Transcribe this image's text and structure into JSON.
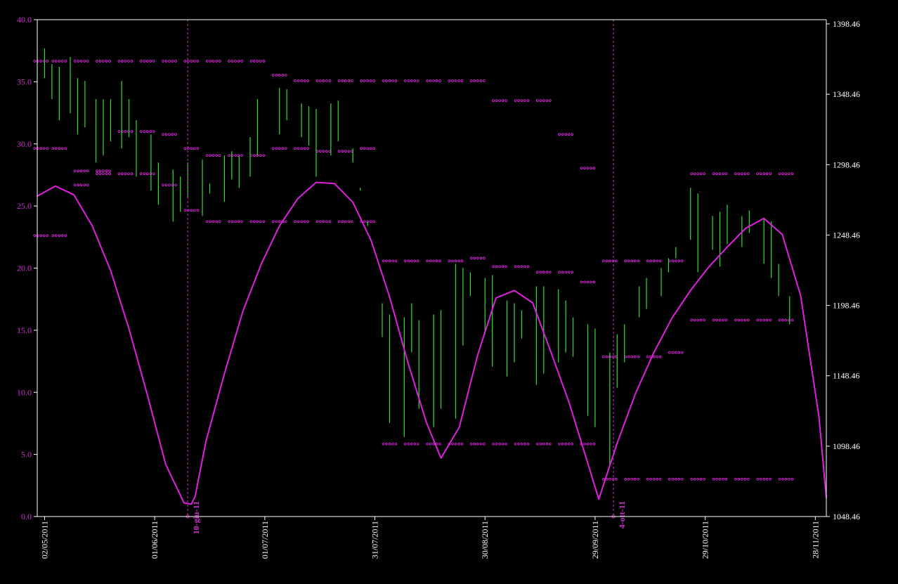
{
  "chart_data": {
    "type": "line",
    "title": "",
    "xlabel": "",
    "ylabel": "",
    "colors": {
      "background": "#000000",
      "axis": "#ffffff",
      "left_tick_label": "#cc33cc",
      "right_tick_label": "#ffffff",
      "oscillator": "#e020e0",
      "bars": "#33dd33",
      "dots": "#e020e0",
      "marker": "#cc33cc"
    },
    "left_axis": {
      "ylim": [
        0,
        40
      ],
      "ticks": [
        "0.0",
        "5.0",
        "10.0",
        "15.0",
        "20.0",
        "25.0",
        "30.0",
        "35.0",
        "40.0"
      ]
    },
    "right_axis": {
      "ylim": [
        1048.46,
        1401.46
      ],
      "ticks": [
        "1048.46",
        "1098.46",
        "1148.46",
        "1198.46",
        "1248.46",
        "1298.46",
        "1348.46",
        "1398.46"
      ]
    },
    "x_axis": {
      "xlim": [
        "2011-04-30",
        "2011-12-01"
      ],
      "ticks": [
        {
          "date": "2011-05-02",
          "label": "02/05/2011"
        },
        {
          "date": "2011-06-01",
          "label": "01/06/2011"
        },
        {
          "date": "2011-07-01",
          "label": "01/07/2011"
        },
        {
          "date": "2011-07-31",
          "label": "31/07/2011"
        },
        {
          "date": "2011-08-30",
          "label": "30/08/2011"
        },
        {
          "date": "2011-09-29",
          "label": "29/09/2011"
        },
        {
          "date": "2011-10-29",
          "label": "29/10/2011"
        },
        {
          "date": "2011-11-28",
          "label": "28/11/2011"
        }
      ]
    },
    "markers": [
      {
        "date": "2011-06-10",
        "label": "10-giu-11"
      },
      {
        "date": "2011-10-04",
        "label": "4-ott-11"
      }
    ],
    "series": [
      {
        "kind": "line",
        "x": [
          "2011-04-30",
          "2011-05-05",
          "2011-05-10",
          "2011-05-15",
          "2011-05-20",
          "2011-05-25",
          "2011-05-30",
          "2011-06-04",
          "2011-06-09",
          "2011-06-11",
          "2011-06-12",
          "2011-06-15",
          "2011-06-20",
          "2011-06-25",
          "2011-06-30",
          "2011-07-05",
          "2011-07-10",
          "2011-07-15",
          "2011-07-20",
          "2011-07-25",
          "2011-07-30",
          "2011-08-04",
          "2011-08-09",
          "2011-08-14",
          "2011-08-18",
          "2011-08-23",
          "2011-08-28",
          "2011-09-02",
          "2011-09-07",
          "2011-09-12",
          "2011-09-17",
          "2011-09-22",
          "2011-09-27",
          "2011-09-30",
          "2011-10-05",
          "2011-10-10",
          "2011-10-15",
          "2011-10-20",
          "2011-10-25",
          "2011-10-30",
          "2011-11-04",
          "2011-11-09",
          "2011-11-14",
          "2011-11-19",
          "2011-11-24",
          "2011-11-29",
          "2011-12-01"
        ],
        "values": [
          25.8,
          26.6,
          25.9,
          23.4,
          19.8,
          15.1,
          9.8,
          4.2,
          1.1,
          1.0,
          1.6,
          6.1,
          11.5,
          16.5,
          20.3,
          23.4,
          25.6,
          26.9,
          26.8,
          25.3,
          22.2,
          17.7,
          12.4,
          7.6,
          4.7,
          7.2,
          13.0,
          17.6,
          18.2,
          17.2,
          13.2,
          9.1,
          4.3,
          1.4,
          5.9,
          9.9,
          13.2,
          16.0,
          18.2,
          20.1,
          21.7,
          23.2,
          24.0,
          22.7,
          17.8,
          8.0,
          1.5
        ]
      },
      {
        "kind": "bars",
        "x": [
          "2011-05-02",
          "2011-05-04",
          "2011-05-06",
          "2011-05-09",
          "2011-05-11",
          "2011-05-13",
          "2011-05-16",
          "2011-05-18",
          "2011-05-20",
          "2011-05-23",
          "2011-05-25",
          "2011-05-27",
          "2011-05-31",
          "2011-06-02",
          "2011-06-06",
          "2011-06-08",
          "2011-06-10",
          "2011-06-14",
          "2011-06-16",
          "2011-06-20",
          "2011-06-22",
          "2011-06-24",
          "2011-06-27",
          "2011-06-29",
          "2011-07-05",
          "2011-07-07",
          "2011-07-11",
          "2011-07-13",
          "2011-07-15",
          "2011-07-19",
          "2011-07-21",
          "2011-07-25",
          "2011-07-27",
          "2011-07-29",
          "2011-08-02",
          "2011-08-04",
          "2011-08-08",
          "2011-08-10",
          "2011-08-12",
          "2011-08-16",
          "2011-08-18",
          "2011-08-22",
          "2011-08-24",
          "2011-08-26",
          "2011-08-30",
          "2011-09-01",
          "2011-09-05",
          "2011-09-07",
          "2011-09-09",
          "2011-09-13",
          "2011-09-15",
          "2011-09-19",
          "2011-09-21",
          "2011-09-23",
          "2011-09-27",
          "2011-09-29",
          "2011-10-03",
          "2011-10-05",
          "2011-10-07",
          "2011-10-11",
          "2011-10-13",
          "2011-10-17",
          "2011-10-19",
          "2011-10-21",
          "2011-10-25",
          "2011-10-27",
          "2011-10-31",
          "2011-11-02",
          "2011-11-04",
          "2011-11-08",
          "2011-11-10",
          "2011-11-14",
          "2011-11-16",
          "2011-11-18",
          "2011-11-21"
        ],
        "low": [
          1360,
          1345,
          1330,
          1335,
          1320,
          1325,
          1300,
          1305,
          1315,
          1310,
          1318,
          1290,
          1280,
          1270,
          1258,
          1265,
          1275,
          1262,
          1278,
          1272,
          1288,
          1282,
          1290,
          1305,
          1320,
          1330,
          1318,
          1312,
          1290,
          1305,
          1315,
          1310,
          1282,
          1255,
          1176,
          1115,
          1105,
          1165,
          1125,
          1112,
          1125,
          1118,
          1170,
          1205,
          1178,
          1155,
          1148,
          1158,
          1175,
          1142,
          1150,
          1158,
          1165,
          1162,
          1120,
          1112,
          1085,
          1140,
          1158,
          1190,
          1196,
          1205,
          1222,
          1232,
          1245,
          1222,
          1238,
          1226,
          1242,
          1240,
          1250,
          1228,
          1218,
          1205,
          1185
        ],
        "high": [
          1381,
          1370,
          1368,
          1375,
          1360,
          1358,
          1345,
          1345,
          1345,
          1358,
          1345,
          1330,
          1320,
          1300,
          1295,
          1290,
          1300,
          1302,
          1285,
          1305,
          1308,
          1305,
          1318,
          1345,
          1353,
          1352,
          1342,
          1340,
          1338,
          1342,
          1344,
          1300,
          1280,
          1258,
          1200,
          1192,
          1190,
          1200,
          1188,
          1192,
          1195,
          1228,
          1225,
          1222,
          1218,
          1220,
          1202,
          1200,
          1195,
          1212,
          1212,
          1210,
          1202,
          1190,
          1185,
          1182,
          1165,
          1178,
          1185,
          1212,
          1218,
          1225,
          1232,
          1240,
          1282,
          1278,
          1262,
          1265,
          1270,
          1262,
          1266,
          1260,
          1258,
          1228,
          1205
        ]
      },
      {
        "kind": "dots",
        "x": [
          "2011-05-01",
          "2011-05-06",
          "2011-05-12",
          "2011-05-18",
          "2011-05-24",
          "2011-05-30",
          "2011-06-05",
          "2011-06-11",
          "2011-06-17",
          "2011-06-23",
          "2011-06-29",
          "2011-07-05",
          "2011-07-11",
          "2011-07-17",
          "2011-07-23",
          "2011-07-29",
          "2011-08-04",
          "2011-08-10",
          "2011-08-16",
          "2011-08-22",
          "2011-08-28",
          "2011-09-03",
          "2011-09-09",
          "2011-09-15",
          "2011-09-21",
          "2011-09-27",
          "2011-10-03",
          "2011-10-09",
          "2011-10-15",
          "2011-10-21",
          "2011-10-27",
          "2011-11-02",
          "2011-11-08",
          "2011-11-14",
          "2011-11-20"
        ],
        "values": [
          1372,
          1372,
          1372,
          1372,
          1372,
          1372,
          1372,
          1372,
          1372,
          1372,
          1372,
          1362,
          1358,
          1358,
          1358,
          1358,
          1358,
          1358,
          1358,
          1358,
          1358,
          1344,
          1344,
          1344,
          1320,
          1296,
          1230,
          1230,
          1230,
          1230,
          1292,
          1292,
          1292,
          1292,
          1292
        ]
      },
      {
        "kind": "dots",
        "x": [
          "2011-05-01",
          "2011-05-06",
          "2011-05-12",
          "2011-05-18",
          "2011-05-24",
          "2011-05-30",
          "2011-06-05",
          "2011-06-11",
          "2011-06-17",
          "2011-06-23",
          "2011-06-29",
          "2011-07-05",
          "2011-07-11",
          "2011-07-17",
          "2011-07-23",
          "2011-07-29",
          "2011-08-04",
          "2011-08-10",
          "2011-08-16",
          "2011-08-22",
          "2011-08-28",
          "2011-09-03",
          "2011-09-09",
          "2011-09-15",
          "2011-09-21",
          "2011-09-27",
          "2011-10-03",
          "2011-10-09",
          "2011-10-15",
          "2011-10-21",
          "2011-10-27",
          "2011-11-02",
          "2011-11-08",
          "2011-11-14",
          "2011-11-20"
        ],
        "values": [
          1310,
          1310,
          1294,
          1294,
          1322,
          1322,
          1320,
          1310,
          1305,
          1305,
          1305,
          1310,
          1310,
          1308,
          1308,
          1310,
          1230,
          1230,
          1230,
          1230,
          1232,
          1226,
          1226,
          1222,
          1222,
          1215,
          1162,
          1162,
          1162,
          1165,
          1188,
          1188,
          1188,
          1188,
          1188
        ]
      },
      {
        "kind": "dots",
        "x": [
          "2011-05-01",
          "2011-05-06",
          "2011-05-12",
          "2011-05-18",
          "2011-05-24",
          "2011-05-30",
          "2011-06-05",
          "2011-06-11",
          "2011-06-17",
          "2011-06-23",
          "2011-06-29",
          "2011-07-05",
          "2011-07-11",
          "2011-07-17",
          "2011-07-23",
          "2011-07-29",
          "2011-08-04",
          "2011-08-10",
          "2011-08-16",
          "2011-08-22",
          "2011-08-28",
          "2011-09-03",
          "2011-09-09",
          "2011-09-15",
          "2011-09-21",
          "2011-09-27",
          "2011-10-03",
          "2011-10-09",
          "2011-10-15",
          "2011-10-21",
          "2011-10-27",
          "2011-11-02",
          "2011-11-08",
          "2011-11-14",
          "2011-11-20"
        ],
        "values": [
          1248,
          1248,
          1284,
          1292,
          1292,
          1292,
          1284,
          1266,
          1258,
          1258,
          1258,
          1258,
          1258,
          1258,
          1258,
          1258,
          1100,
          1100,
          1100,
          1100,
          1100,
          1100,
          1100,
          1100,
          1100,
          1100,
          1075,
          1075,
          1075,
          1075,
          1075,
          1075,
          1075,
          1075,
          1075
        ]
      }
    ]
  }
}
